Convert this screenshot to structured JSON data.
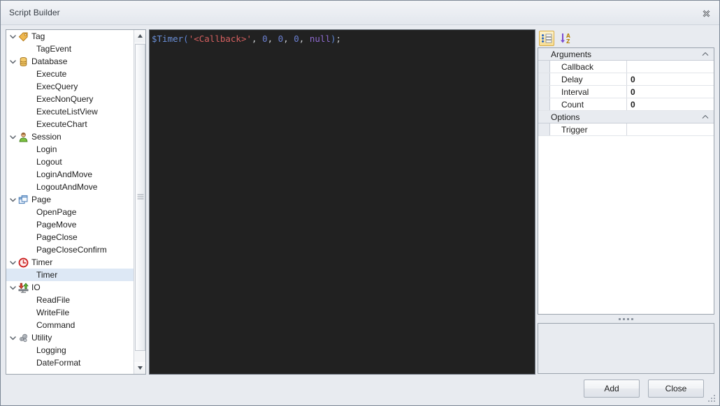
{
  "window": {
    "title": "Script Builder",
    "close_icon": "close-icon"
  },
  "tree": {
    "nodes": [
      {
        "label": "Tag",
        "type": "group",
        "icon": "tag-icon",
        "expanded": true
      },
      {
        "label": "TagEvent",
        "type": "leaf"
      },
      {
        "label": "Database",
        "type": "group",
        "icon": "database-icon",
        "expanded": true
      },
      {
        "label": "Execute",
        "type": "leaf"
      },
      {
        "label": "ExecQuery",
        "type": "leaf"
      },
      {
        "label": "ExecNonQuery",
        "type": "leaf"
      },
      {
        "label": "ExecuteListView",
        "type": "leaf"
      },
      {
        "label": "ExecuteChart",
        "type": "leaf"
      },
      {
        "label": "Session",
        "type": "group",
        "icon": "user-icon",
        "expanded": true
      },
      {
        "label": "Login",
        "type": "leaf"
      },
      {
        "label": "Logout",
        "type": "leaf"
      },
      {
        "label": "LoginAndMove",
        "type": "leaf"
      },
      {
        "label": "LogoutAndMove",
        "type": "leaf"
      },
      {
        "label": "Page",
        "type": "group",
        "icon": "page-icon",
        "expanded": true
      },
      {
        "label": "OpenPage",
        "type": "leaf"
      },
      {
        "label": "PageMove",
        "type": "leaf"
      },
      {
        "label": "PageClose",
        "type": "leaf"
      },
      {
        "label": "PageCloseConfirm",
        "type": "leaf"
      },
      {
        "label": "Timer",
        "type": "group",
        "icon": "timer-icon",
        "expanded": true
      },
      {
        "label": "Timer",
        "type": "leaf",
        "selected": true
      },
      {
        "label": "IO",
        "type": "group",
        "icon": "io-icon",
        "expanded": true
      },
      {
        "label": "ReadFile",
        "type": "leaf"
      },
      {
        "label": "WriteFile",
        "type": "leaf"
      },
      {
        "label": "Command",
        "type": "leaf"
      },
      {
        "label": "Utility",
        "type": "group",
        "icon": "gears-icon",
        "expanded": true
      },
      {
        "label": "Logging",
        "type": "leaf"
      },
      {
        "label": "DateFormat",
        "type": "leaf"
      }
    ],
    "scrollbar": {
      "up_icon": "scroll-up-icon",
      "down_icon": "scroll-down-icon"
    }
  },
  "editor": {
    "code_tokens": [
      {
        "text": "$Timer",
        "kind": "fn"
      },
      {
        "text": "(",
        "kind": "punc"
      },
      {
        "text": "'<Callback>'",
        "kind": "str"
      },
      {
        "text": ", ",
        "kind": "plain"
      },
      {
        "text": "0",
        "kind": "num"
      },
      {
        "text": ", ",
        "kind": "plain"
      },
      {
        "text": "0",
        "kind": "num"
      },
      {
        "text": ", ",
        "kind": "plain"
      },
      {
        "text": "0",
        "kind": "num"
      },
      {
        "text": ", ",
        "kind": "plain"
      },
      {
        "text": "null",
        "kind": "kw"
      },
      {
        "text": ")",
        "kind": "punc"
      },
      {
        "text": ";",
        "kind": "plain"
      }
    ],
    "code_plain": "$Timer('<Callback>', 0, 0, 0, null);"
  },
  "property_toolbar": {
    "categorized_icon": "categorized-view-icon",
    "alphabetical_icon": "alphabetical-sort-icon"
  },
  "property_grid": {
    "categories": [
      {
        "name": "Arguments",
        "collapse_icon": "chevron-up-icon",
        "rows": [
          {
            "name": "Callback",
            "value": ""
          },
          {
            "name": "Delay",
            "value": "0"
          },
          {
            "name": "Interval",
            "value": "0"
          },
          {
            "name": "Count",
            "value": "0"
          }
        ]
      },
      {
        "name": "Options",
        "collapse_icon": "chevron-up-icon",
        "rows": [
          {
            "name": "Trigger",
            "value": ""
          }
        ]
      }
    ]
  },
  "description_panel": {
    "text": ""
  },
  "footer": {
    "add_label": "Add",
    "close_label": "Close",
    "grip_icon": "resize-grip-icon"
  },
  "colors": {
    "window_bg": "#e8ebf0",
    "editor_bg": "#212121",
    "selection": "#dde8f5",
    "toolbar_active": "#f7dd93",
    "border": "#9aa3ad"
  }
}
